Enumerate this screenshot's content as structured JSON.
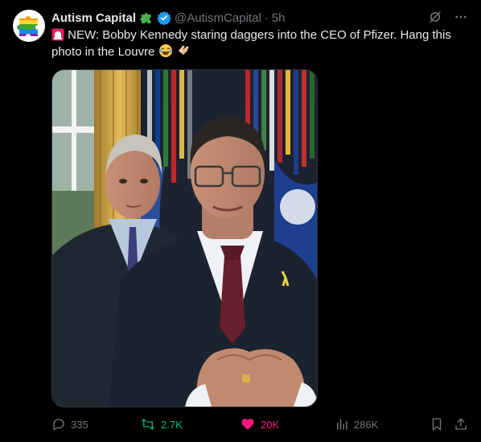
{
  "tweet": {
    "display_name": "Autism Capital",
    "handle": "@AutismCapital",
    "separator": "·",
    "time": "5h",
    "text_part1": "NEW: Bobby Kennedy staring daggers into the CEO of Pfizer. Hang this photo in the Louvre",
    "prefix_emoji": "rotating-light-icon",
    "suffix_emojis": [
      "joy-emoji-icon",
      "clapping-hands-icon"
    ]
  },
  "actions": {
    "replies": "335",
    "reposts": "2.7K",
    "likes": "20K",
    "views": "286K"
  },
  "colors": {
    "background": "#000000",
    "text": "#e7e9ea",
    "muted": "#71767b",
    "verified": "#1d9bf0",
    "repost_active": "#00ba7c",
    "like_active": "#f91880"
  }
}
